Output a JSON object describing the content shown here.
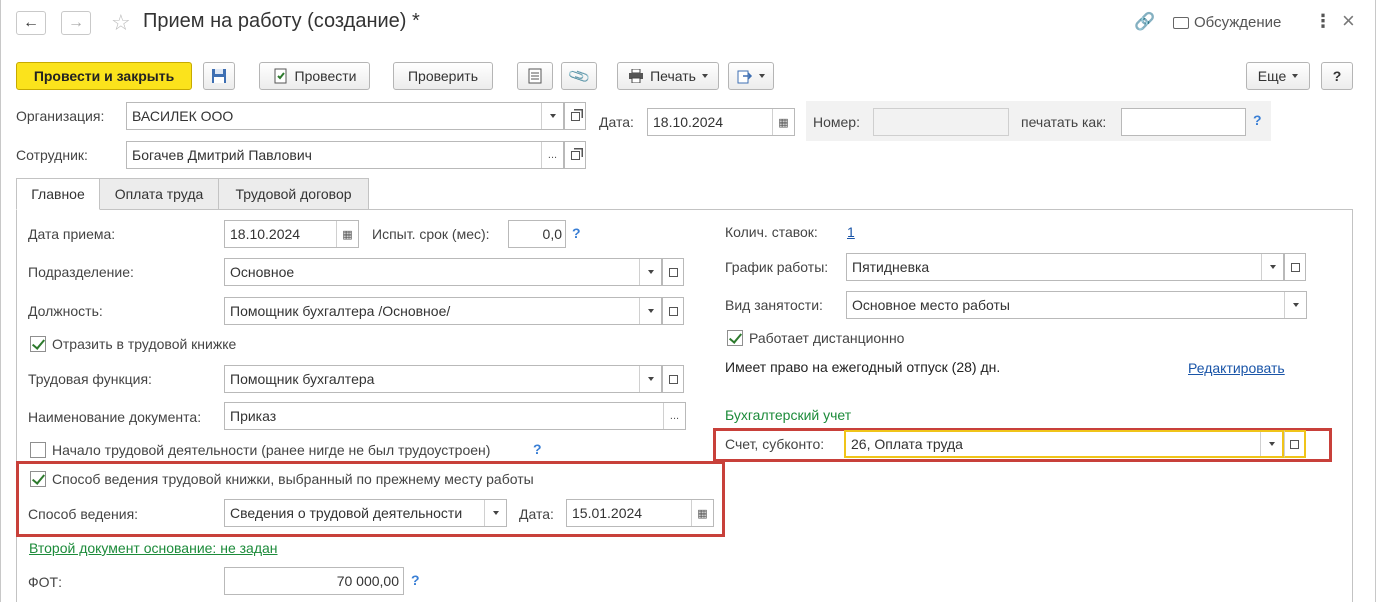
{
  "window": {
    "title": "Прием на работу (создание) *",
    "discussion": "Обсуждение"
  },
  "toolbar": {
    "post_and_close": "Провести и закрыть",
    "post": "Провести",
    "check": "Проверить",
    "print": "Печать",
    "more": "Еще",
    "help": "?"
  },
  "header": {
    "org_label": "Организация:",
    "org_value": "ВАСИЛЕК ООО",
    "date_label": "Дата:",
    "date_value": "18.10.2024",
    "number_label": "Номер:",
    "number_value": "",
    "print_as_label": "печатать как:",
    "print_as_value": "",
    "help": "?",
    "employee_label": "Сотрудник:",
    "employee_value": "Богачев Дмитрий Павлович"
  },
  "tabs": [
    {
      "label": "Главное"
    },
    {
      "label": "Оплата труда"
    },
    {
      "label": "Трудовой договор"
    }
  ],
  "main": {
    "hire_date_label": "Дата приема:",
    "hire_date_value": "18.10.2024",
    "probation_label": "Испыт. срок (мес):",
    "probation_value": "0,0",
    "division_label": "Подразделение:",
    "division_value": "Основное",
    "position_label": "Должность:",
    "position_value": "Помощник бухгалтера /Основное/",
    "reflect_label": "Отразить в трудовой книжке",
    "labor_function_label": "Трудовая функция:",
    "labor_function_value": "Помощник бухгалтера",
    "doc_name_label": "Наименование документа:",
    "doc_name_value": "Приказ",
    "first_job_label": "Начало трудовой деятельности (ранее нигде не был трудоустроен)",
    "method_prev_label": "Способ ведения трудовой книжки, выбранный по прежнему месту работы",
    "method_label": "Способ ведения:",
    "method_value": "Сведения о трудовой деятельности",
    "method_date_label": "Дата:",
    "method_date_value": "15.01.2024",
    "second_doc_link": "Второй документ основание: не задан",
    "fot_label": "ФОТ:",
    "fot_value": "70 000,00",
    "rates_label": "Колич. ставок:",
    "rates_value": "1",
    "schedule_label": "График работы:",
    "schedule_value": "Пятидневка",
    "employment_label": "Вид занятости:",
    "employment_value": "Основное место работы",
    "remote_label": "Работает дистанционно",
    "vacation_text": "Имеет право на ежегодный отпуск (28) дн.",
    "edit_link": "Редактировать",
    "accounting_header": "Бухгалтерский учет",
    "account_label": "Счет, субконто:",
    "account_value": "26, Оплата труда",
    "help": "?"
  },
  "colors": {
    "primary_button": "#fbe31c",
    "highlight_border": "#c8403a",
    "link": "#1a55a8",
    "green_link": "#1c8b3a"
  }
}
